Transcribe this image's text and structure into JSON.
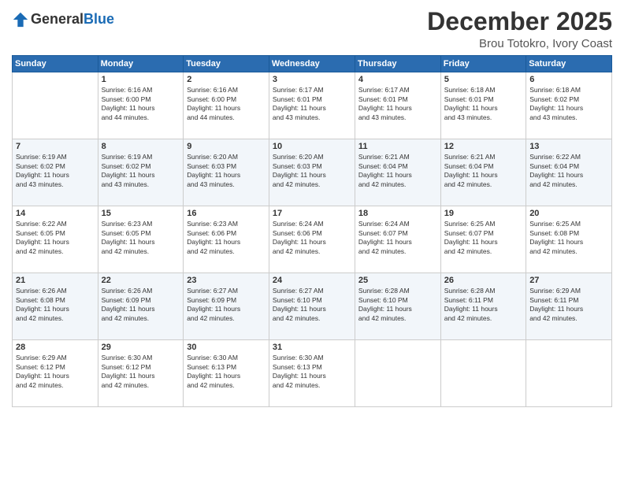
{
  "header": {
    "logo_general": "General",
    "logo_blue": "Blue",
    "main_title": "December 2025",
    "subtitle": "Brou Totokro, Ivory Coast"
  },
  "calendar": {
    "days_of_week": [
      "Sunday",
      "Monday",
      "Tuesday",
      "Wednesday",
      "Thursday",
      "Friday",
      "Saturday"
    ],
    "weeks": [
      [
        {
          "day": "",
          "sunrise": "",
          "sunset": "",
          "daylight": ""
        },
        {
          "day": "1",
          "sunrise": "Sunrise: 6:16 AM",
          "sunset": "Sunset: 6:00 PM",
          "daylight": "Daylight: 11 hours and 44 minutes."
        },
        {
          "day": "2",
          "sunrise": "Sunrise: 6:16 AM",
          "sunset": "Sunset: 6:00 PM",
          "daylight": "Daylight: 11 hours and 44 minutes."
        },
        {
          "day": "3",
          "sunrise": "Sunrise: 6:17 AM",
          "sunset": "Sunset: 6:01 PM",
          "daylight": "Daylight: 11 hours and 43 minutes."
        },
        {
          "day": "4",
          "sunrise": "Sunrise: 6:17 AM",
          "sunset": "Sunset: 6:01 PM",
          "daylight": "Daylight: 11 hours and 43 minutes."
        },
        {
          "day": "5",
          "sunrise": "Sunrise: 6:18 AM",
          "sunset": "Sunset: 6:01 PM",
          "daylight": "Daylight: 11 hours and 43 minutes."
        },
        {
          "day": "6",
          "sunrise": "Sunrise: 6:18 AM",
          "sunset": "Sunset: 6:02 PM",
          "daylight": "Daylight: 11 hours and 43 minutes."
        }
      ],
      [
        {
          "day": "7",
          "sunrise": "Sunrise: 6:19 AM",
          "sunset": "Sunset: 6:02 PM",
          "daylight": "Daylight: 11 hours and 43 minutes."
        },
        {
          "day": "8",
          "sunrise": "Sunrise: 6:19 AM",
          "sunset": "Sunset: 6:02 PM",
          "daylight": "Daylight: 11 hours and 43 minutes."
        },
        {
          "day": "9",
          "sunrise": "Sunrise: 6:20 AM",
          "sunset": "Sunset: 6:03 PM",
          "daylight": "Daylight: 11 hours and 43 minutes."
        },
        {
          "day": "10",
          "sunrise": "Sunrise: 6:20 AM",
          "sunset": "Sunset: 6:03 PM",
          "daylight": "Daylight: 11 hours and 42 minutes."
        },
        {
          "day": "11",
          "sunrise": "Sunrise: 6:21 AM",
          "sunset": "Sunset: 6:04 PM",
          "daylight": "Daylight: 11 hours and 42 minutes."
        },
        {
          "day": "12",
          "sunrise": "Sunrise: 6:21 AM",
          "sunset": "Sunset: 6:04 PM",
          "daylight": "Daylight: 11 hours and 42 minutes."
        },
        {
          "day": "13",
          "sunrise": "Sunrise: 6:22 AM",
          "sunset": "Sunset: 6:04 PM",
          "daylight": "Daylight: 11 hours and 42 minutes."
        }
      ],
      [
        {
          "day": "14",
          "sunrise": "Sunrise: 6:22 AM",
          "sunset": "Sunset: 6:05 PM",
          "daylight": "Daylight: 11 hours and 42 minutes."
        },
        {
          "day": "15",
          "sunrise": "Sunrise: 6:23 AM",
          "sunset": "Sunset: 6:05 PM",
          "daylight": "Daylight: 11 hours and 42 minutes."
        },
        {
          "day": "16",
          "sunrise": "Sunrise: 6:23 AM",
          "sunset": "Sunset: 6:06 PM",
          "daylight": "Daylight: 11 hours and 42 minutes."
        },
        {
          "day": "17",
          "sunrise": "Sunrise: 6:24 AM",
          "sunset": "Sunset: 6:06 PM",
          "daylight": "Daylight: 11 hours and 42 minutes."
        },
        {
          "day": "18",
          "sunrise": "Sunrise: 6:24 AM",
          "sunset": "Sunset: 6:07 PM",
          "daylight": "Daylight: 11 hours and 42 minutes."
        },
        {
          "day": "19",
          "sunrise": "Sunrise: 6:25 AM",
          "sunset": "Sunset: 6:07 PM",
          "daylight": "Daylight: 11 hours and 42 minutes."
        },
        {
          "day": "20",
          "sunrise": "Sunrise: 6:25 AM",
          "sunset": "Sunset: 6:08 PM",
          "daylight": "Daylight: 11 hours and 42 minutes."
        }
      ],
      [
        {
          "day": "21",
          "sunrise": "Sunrise: 6:26 AM",
          "sunset": "Sunset: 6:08 PM",
          "daylight": "Daylight: 11 hours and 42 minutes."
        },
        {
          "day": "22",
          "sunrise": "Sunrise: 6:26 AM",
          "sunset": "Sunset: 6:09 PM",
          "daylight": "Daylight: 11 hours and 42 minutes."
        },
        {
          "day": "23",
          "sunrise": "Sunrise: 6:27 AM",
          "sunset": "Sunset: 6:09 PM",
          "daylight": "Daylight: 11 hours and 42 minutes."
        },
        {
          "day": "24",
          "sunrise": "Sunrise: 6:27 AM",
          "sunset": "Sunset: 6:10 PM",
          "daylight": "Daylight: 11 hours and 42 minutes."
        },
        {
          "day": "25",
          "sunrise": "Sunrise: 6:28 AM",
          "sunset": "Sunset: 6:10 PM",
          "daylight": "Daylight: 11 hours and 42 minutes."
        },
        {
          "day": "26",
          "sunrise": "Sunrise: 6:28 AM",
          "sunset": "Sunset: 6:11 PM",
          "daylight": "Daylight: 11 hours and 42 minutes."
        },
        {
          "day": "27",
          "sunrise": "Sunrise: 6:29 AM",
          "sunset": "Sunset: 6:11 PM",
          "daylight": "Daylight: 11 hours and 42 minutes."
        }
      ],
      [
        {
          "day": "28",
          "sunrise": "Sunrise: 6:29 AM",
          "sunset": "Sunset: 6:12 PM",
          "daylight": "Daylight: 11 hours and 42 minutes."
        },
        {
          "day": "29",
          "sunrise": "Sunrise: 6:30 AM",
          "sunset": "Sunset: 6:12 PM",
          "daylight": "Daylight: 11 hours and 42 minutes."
        },
        {
          "day": "30",
          "sunrise": "Sunrise: 6:30 AM",
          "sunset": "Sunset: 6:13 PM",
          "daylight": "Daylight: 11 hours and 42 minutes."
        },
        {
          "day": "31",
          "sunrise": "Sunrise: 6:30 AM",
          "sunset": "Sunset: 6:13 PM",
          "daylight": "Daylight: 11 hours and 42 minutes."
        },
        {
          "day": "",
          "sunrise": "",
          "sunset": "",
          "daylight": ""
        },
        {
          "day": "",
          "sunrise": "",
          "sunset": "",
          "daylight": ""
        },
        {
          "day": "",
          "sunrise": "",
          "sunset": "",
          "daylight": ""
        }
      ]
    ]
  }
}
